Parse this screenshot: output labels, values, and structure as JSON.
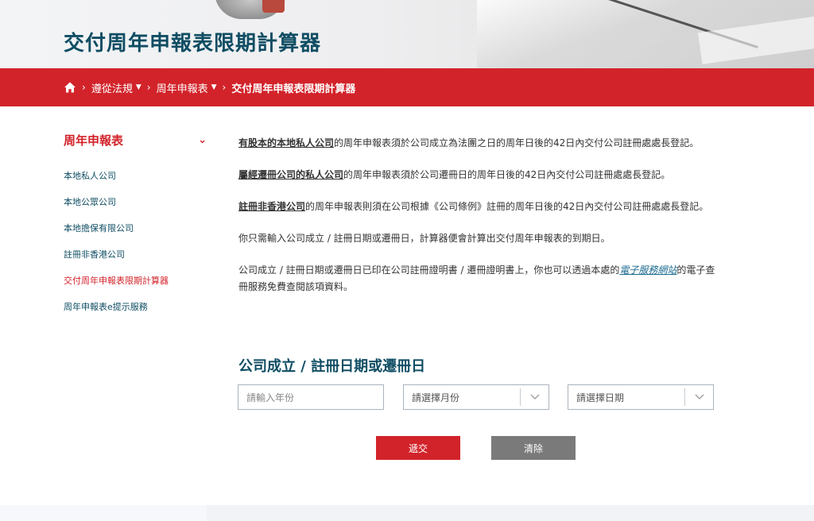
{
  "header": {
    "title": "交付周年申報表限期計算器"
  },
  "breadcrumb": {
    "home_icon": "home-icon",
    "items": [
      {
        "label": "遵從法規",
        "has_dropdown": true
      },
      {
        "label": "周年申報表",
        "has_dropdown": true
      },
      {
        "label": "交付周年申報表限期計算器",
        "has_dropdown": false
      }
    ]
  },
  "sidebar": {
    "title": "周年申報表",
    "items": [
      {
        "label": "本地私人公司"
      },
      {
        "label": "本地公眾公司"
      },
      {
        "label": "本地擔保有限公司"
      },
      {
        "label": "註冊非香港公司"
      },
      {
        "label": "交付周年申報表限期計算器",
        "active": true
      },
      {
        "label": "周年申報表e提示服務"
      }
    ]
  },
  "content": {
    "p1_link": "有股本的本地私人公司",
    "p1_text": "的周年申報表須於公司成立為法團之日的周年日後的42日內交付公司註冊處處長登記。",
    "p2_link": "屬經遷冊公司的私人公司",
    "p2_text": "的周年申報表須於公司遷冊日的周年日後的42日內交付公司註冊處處長登記。",
    "p3_link": "註冊非香港公司",
    "p3_text": "的周年申報表則須在公司根據《公司條例》註冊的周年日後的42日內交付公司註冊處處長登記。",
    "p4_text": "你只需輸入公司成立 / 註冊日期或遷冊日，計算器便會計算出交付周年申報表的到期日。",
    "p5_text_a": "公司成立 / 註冊日期或遷冊日已印在公司註冊證明書 / 遷冊證明書上，你也可以透過本處的",
    "p5_link": "電子服務網站",
    "p5_text_b": "的電子查冊服務免費查閱該項資料。"
  },
  "form": {
    "title": "公司成立 / 註冊日期或遷冊日",
    "year_placeholder": "請輸入年份",
    "month_selected": "請選擇月份",
    "day_selected": "請選擇日期",
    "submit_label": "遞交",
    "clear_label": "清除"
  },
  "colors": {
    "brand_red": "#d2232a",
    "title_teal": "#0f4d63",
    "clear_gray": "#7a7a7a"
  }
}
